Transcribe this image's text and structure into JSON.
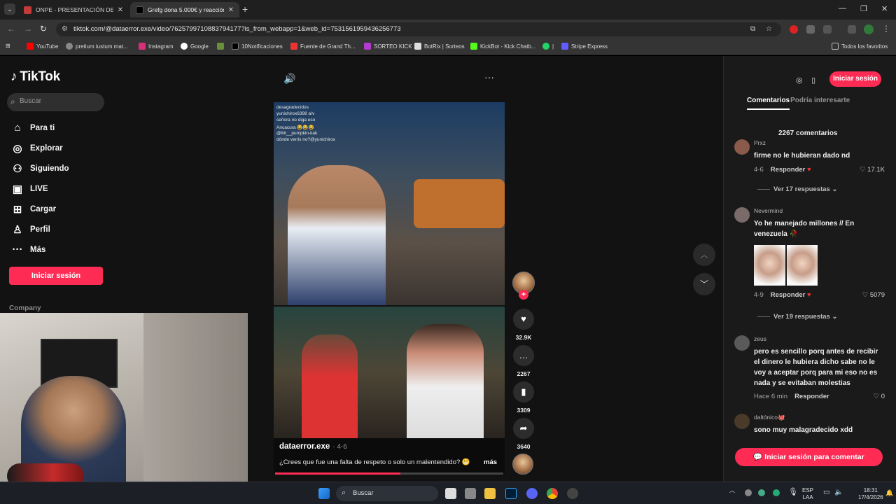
{
  "browser": {
    "tabs": [
      {
        "title": "ONPE - PRESENTACIÓN DE RE",
        "active": false
      },
      {
        "title": "Grefg dona 5.000€ y reacción d",
        "active": true
      }
    ],
    "url": "tiktok.com/@dataerror.exe/video/7625799710883794177?is_from_webapp=1&web_id=7531561959436256773",
    "bookmarks": [
      "YouTube",
      "pretium iustum mat...",
      "Instagram",
      "Google",
      "10Notificaciones",
      "Fuente de Grand Th...",
      "SORTEO KICK",
      "BotRix | Sorteos",
      "KickBot - Kick Chatb...",
      "Stripe Express"
    ],
    "bookmarks_right": "Todos los favoritos"
  },
  "tiktok": {
    "logo": "TikTok",
    "search_placeholder": "Buscar",
    "nav": [
      {
        "label": "Para ti",
        "icon": "home-icon"
      },
      {
        "label": "Explorar",
        "icon": "compass-icon"
      },
      {
        "label": "Siguiendo",
        "icon": "people-icon"
      },
      {
        "label": "LIVE",
        "icon": "live-icon"
      },
      {
        "label": "Cargar",
        "icon": "upload-icon"
      },
      {
        "label": "Perfil",
        "icon": "profile-icon"
      },
      {
        "label": "Más",
        "icon": "more-icon"
      }
    ],
    "login_label": "Iniciar sesión",
    "company_label": "Company",
    "video": {
      "username": "dataerror.exe",
      "date": "4-6",
      "description": "¿Crees que fue una falta de respeto o solo un malentendido? 😬",
      "more_label": "más",
      "progress": 0.55,
      "chat_lines": [
        "desagradecidos",
        "yunichirox6398 a/v",
        "señora no diga eso",
        "Ancacura 😂😂😂",
        "@Mr__pumpkin-kak",
        "dónde venís no?@yunichirox"
      ]
    },
    "actions": {
      "likes": "32.9K",
      "comments": "2267",
      "saves": "3309",
      "shares": "3640"
    }
  },
  "panel": {
    "login_label": "Iniciar sesión",
    "tabs": [
      "Comentarios",
      "Podría interesarte"
    ],
    "comment_count": "2267 comentarios",
    "reply_label": "Responder",
    "comments": [
      {
        "user": "Prxz",
        "text": "firme no le hubieran dado nd",
        "date": "4-6",
        "likes": "17.1K",
        "replies": "Ver 17 respuestas",
        "avatar_color": "#8a5a4a"
      },
      {
        "user": "Nevermind",
        "text": "Yo he manejado millones // En venezuela 🥀",
        "date": "4-9",
        "likes": "5079",
        "replies": "Ver 19 respuestas",
        "avatar_color": "#7a6a6a"
      },
      {
        "user": "zeus",
        "text": "pero es sencillo porq antes de recibir el dinero le hubiera dicho sabe no le voy a aceptar porq para mi eso no es nada y se evitaban molestias",
        "date": "Hace 6 min",
        "likes": "0",
        "replies": "",
        "avatar_color": "#5a5a5a"
      },
      {
        "user": "daltónico🐙",
        "text": "sono muy malagradecido xdd",
        "date": "",
        "likes": "",
        "replies": "",
        "avatar_color": "#4a3a2a"
      }
    ],
    "comment_login_label": "Iniciar sesión para comentar"
  },
  "taskbar": {
    "search_label": "Buscar",
    "lang_top": "ESP",
    "lang_bottom": "LAA",
    "time": "18:31",
    "date": "17/4/2026"
  },
  "colors": {
    "accent": "#fe2c55",
    "page_bg": "#121212",
    "panel_bg": "#1a1a1a"
  }
}
